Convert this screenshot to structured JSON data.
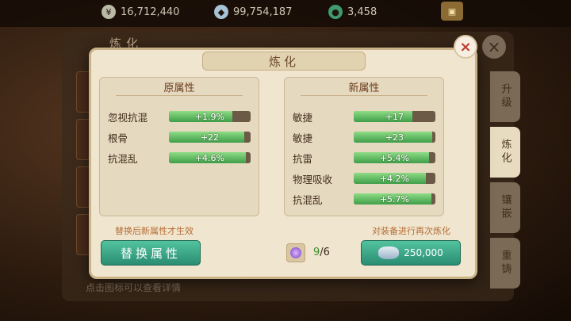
{
  "currency": {
    "coins": "16,712,440",
    "silver": "99,754,187",
    "jade": "3,458"
  },
  "back_panel": {
    "title": "炼化",
    "bottom_hint": "点击图标可以查看详情"
  },
  "side_tabs": [
    {
      "label": "升级",
      "active": false
    },
    {
      "label": "炼化",
      "active": true
    },
    {
      "label": "镶嵌",
      "active": false
    },
    {
      "label": "重铸",
      "active": false
    }
  ],
  "dialog": {
    "title": "炼化",
    "original": {
      "title": "原属性",
      "attributes": [
        {
          "name": "忽视抗混",
          "value": "+1.9%",
          "fill": 0.78
        },
        {
          "name": "根骨",
          "value": "+22",
          "fill": 0.92
        },
        {
          "name": "抗混乱",
          "value": "+4.6%",
          "fill": 0.94
        }
      ]
    },
    "new": {
      "title": "新属性",
      "attributes": [
        {
          "name": "敏捷",
          "value": "+17",
          "fill": 0.72
        },
        {
          "name": "敏捷",
          "value": "+23",
          "fill": 0.96
        },
        {
          "name": "抗雷",
          "value": "+5.4%",
          "fill": 0.92
        },
        {
          "name": "物理吸收",
          "value": "+4.2%",
          "fill": 0.88
        },
        {
          "name": "抗混乱",
          "value": "+5.7%",
          "fill": 0.95
        }
      ]
    },
    "hint_left": "替换后新属性才生效",
    "hint_right": "对装备进行再次炼化",
    "replace_button": "替换属性",
    "refine_cost": "250,000",
    "gem_have": "9",
    "gem_sep": "/",
    "gem_need": "6"
  },
  "colors": {
    "accent_green": "#2a8d72",
    "bar_fill": "#3f9e49",
    "close_red": "#c0392b"
  }
}
